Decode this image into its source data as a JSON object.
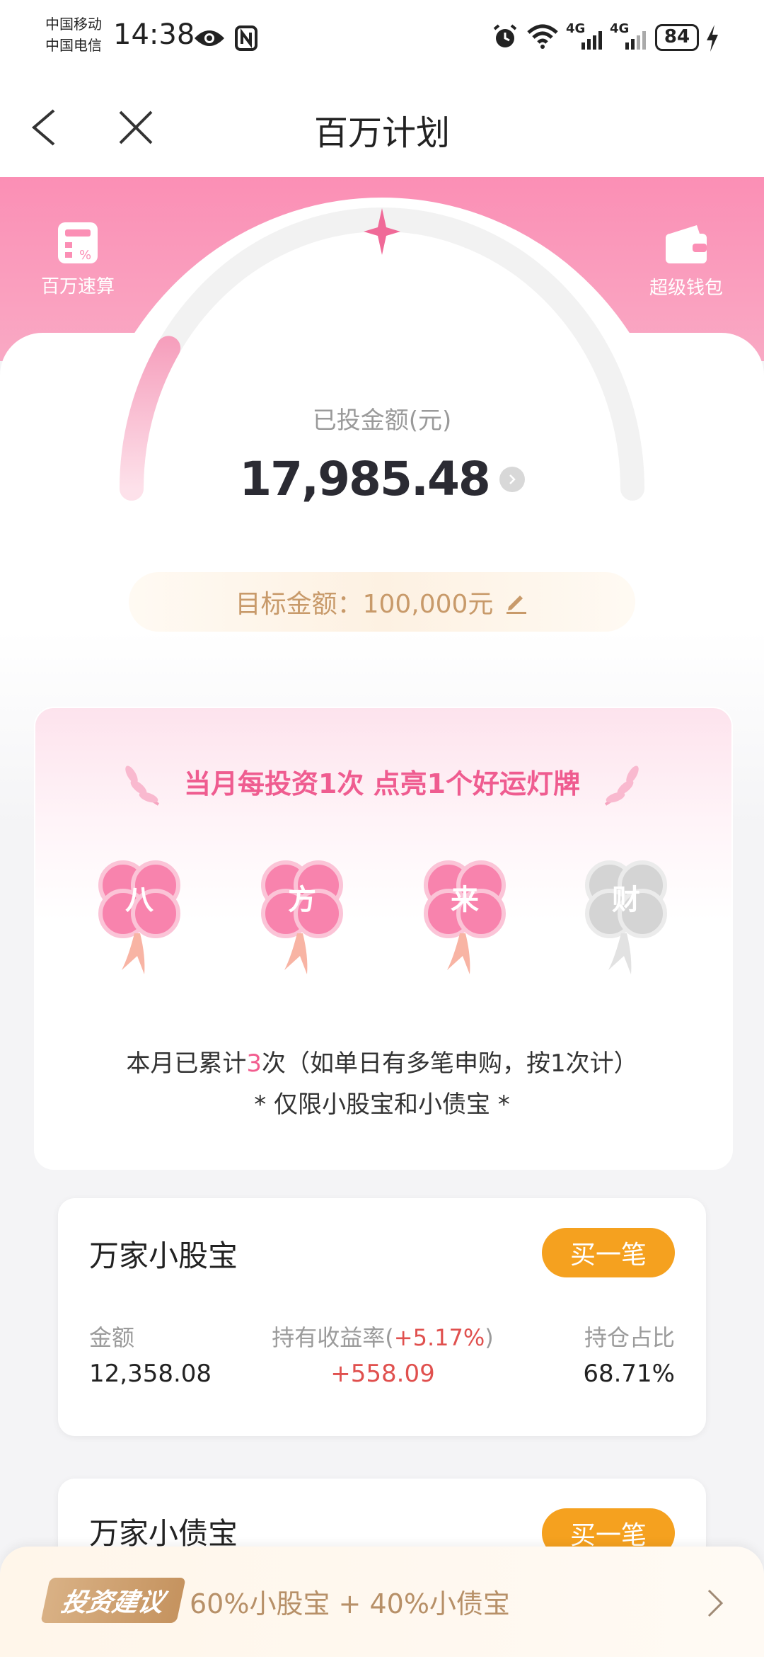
{
  "status_bar": {
    "carrier1": "中国移动",
    "carrier2": "中国电信",
    "time": "14:38",
    "net1": "4G",
    "net2": "4G",
    "battery": "84",
    "icons": [
      "eye-icon",
      "nfc-icon",
      "alarm-icon",
      "wifi-icon",
      "signal-icon",
      "charging-icon"
    ]
  },
  "nav": {
    "title": "百万计划"
  },
  "header": {
    "left_label": "百万速算",
    "right_label": "超级钱包"
  },
  "invested": {
    "label": "已投金额(元)",
    "value": "17,985.48",
    "progress": 0.18
  },
  "target": {
    "label": "目标金额：100,000元"
  },
  "lucky": {
    "title": "当月每投资1次 点亮1个好运灯牌",
    "chars": [
      {
        "char": "八",
        "lit": true
      },
      {
        "char": "方",
        "lit": true
      },
      {
        "char": "来",
        "lit": true
      },
      {
        "char": "财",
        "lit": false
      }
    ],
    "count_prefix": "本月已累计",
    "count_value": "3",
    "count_suffix": "次（如单日有多笔申购，按1次计）",
    "note": "* 仅限小股宝和小债宝 *"
  },
  "funds": [
    {
      "name": "万家小股宝",
      "buy_label": "买一笔",
      "amount_label": "金额",
      "amount": "12,358.08",
      "yield_label": "持有收益率(",
      "yield_rate": "+5.17%",
      "yield_close": ")",
      "profit": "+558.09",
      "ratio_label": "持仓占比",
      "ratio": "68.71%"
    },
    {
      "name": "万家小债宝",
      "buy_label": "买一笔"
    }
  ],
  "bottom_tip": {
    "tag": "投资建议",
    "text": "60%小股宝 + 40%小债宝"
  },
  "colors": {
    "pink": "#fb8fb5",
    "accent_pink": "#ef5c90",
    "orange_button": "#f5a11f",
    "gold_text": "#c89a6a",
    "red_value": "#e0504e"
  }
}
